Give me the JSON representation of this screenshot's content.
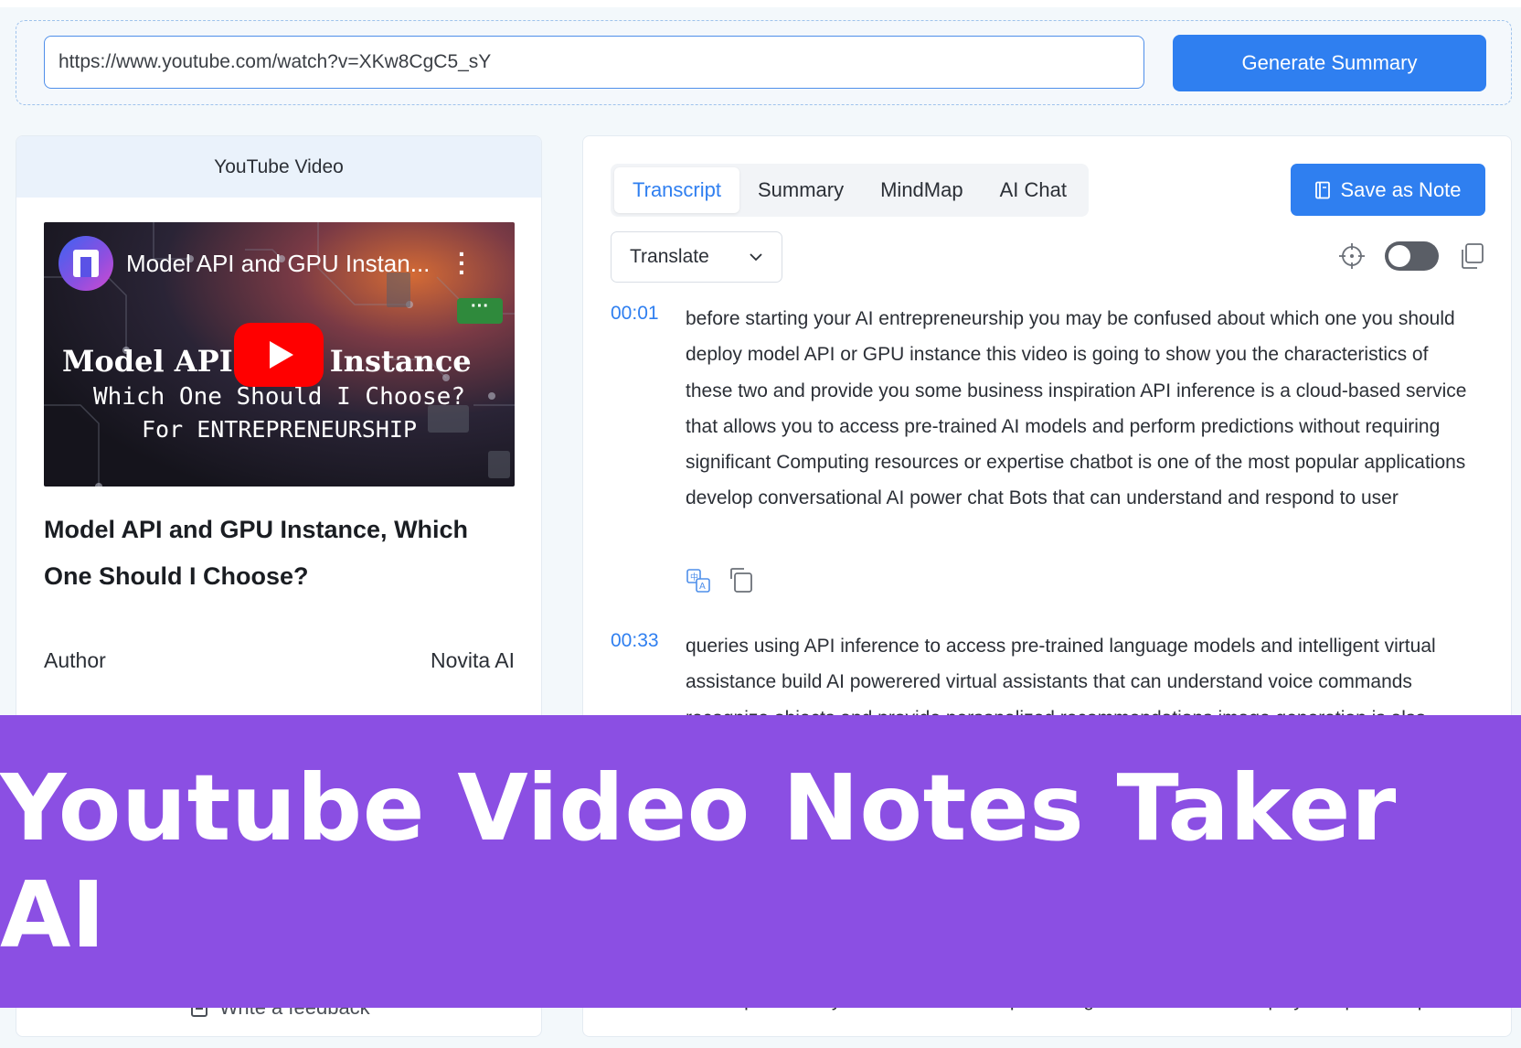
{
  "url_bar": {
    "value": "https://www.youtube.com/watch?v=XKw8CgC5_sY",
    "generate_label": "Generate Summary"
  },
  "left_panel": {
    "header": "YouTube Video",
    "thumbnail": {
      "channel_title": "Model API and GPU Instan...",
      "headline": "Model API a    PU Instance",
      "line2": "Which One Should I Choose?",
      "line3": "For ENTREPRENEURSHIP"
    },
    "video_title": "Model API and GPU Instance, Which One Should I Choose?",
    "author_label": "Author",
    "author_value": "Novita AI",
    "feedback_label": "Write a feedback"
  },
  "right_panel": {
    "tabs": [
      {
        "label": "Transcript",
        "active": true
      },
      {
        "label": "Summary",
        "active": false
      },
      {
        "label": "MindMap",
        "active": false
      },
      {
        "label": "AI Chat",
        "active": false
      }
    ],
    "save_label": "Save as Note",
    "translate_label": "Translate",
    "toggle_on": false,
    "segments": [
      {
        "time": "00:01",
        "text": "before starting your AI entrepreneurship you may be confused about which one you should deploy model API or GPU instance this video is going to show you the characteristics of these two and provide you some business inspiration API inference is a cloud-based service that allows you to access pre-trained AI models and perform predictions without requiring significant Computing resources or expertise chatbot is one of the most popular applications develop conversational AI power chat Bots that can understand and respond to user"
      },
      {
        "time": "00:33",
        "text": "queries using API inference to access pre-trained language models and intelligent virtual assistance build AI powerered virtual assistants that can understand voice commands recognize objects and provide personalized recommendations image generation is also"
      }
    ],
    "partial_bottom_text": "er computationally intensive tasks deep learning models train and deploy complex deep"
  },
  "banner": {
    "text": "Youtube Video Notes Taker AI",
    "color": "#8b4fe3"
  },
  "colors": {
    "accent": "#2f7ff0",
    "background": "#f3f8fb"
  }
}
